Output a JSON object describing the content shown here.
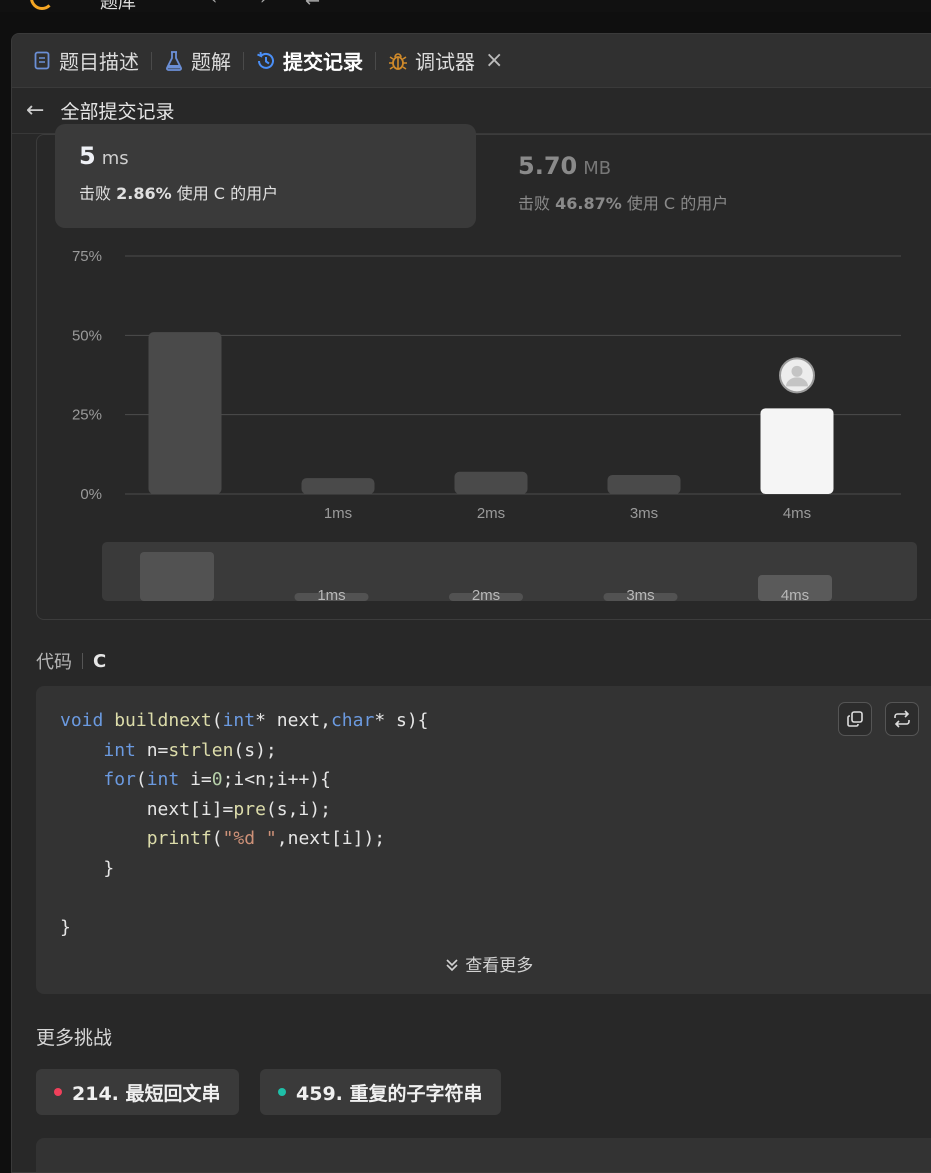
{
  "topbar": {
    "title": "题库",
    "nav_back": "‹",
    "nav_forward": "›",
    "nav_shuffle": "⇄"
  },
  "tabs": [
    {
      "label": "题目描述",
      "icon": "document-icon"
    },
    {
      "label": "题解",
      "icon": "flask-icon"
    },
    {
      "label": "提交记录",
      "icon": "history-icon"
    },
    {
      "label": "调试器",
      "icon": "bug-icon"
    }
  ],
  "tab_close": "×",
  "subheader": {
    "back": "←",
    "title": "全部提交记录"
  },
  "runtime": {
    "value": "5",
    "unit": "ms",
    "beat_prefix": "击败",
    "beat_pct": "2.86%",
    "beat_suffix": "使用 C 的用户"
  },
  "memory": {
    "value": "5.70",
    "unit": "MB",
    "beat_prefix": "击败",
    "beat_pct": "46.87%",
    "beat_suffix": "使用 C 的用户"
  },
  "chart_data": {
    "type": "bar",
    "categories": [
      "",
      "1ms",
      "2ms",
      "3ms",
      "4ms"
    ],
    "values": [
      51,
      5,
      7,
      6,
      27
    ],
    "highlight_index": 4,
    "y_ticks": [
      "75%",
      "50%",
      "25%",
      "0%"
    ],
    "ylim": [
      0,
      75
    ],
    "grid": true,
    "colors": {
      "bar": "#4a4a4a",
      "highlight": "#f5f5f5",
      "grid": "#4d4d4d",
      "tick": "#9a9a9a"
    },
    "overview": {
      "values": [
        51,
        5,
        7,
        6,
        27
      ]
    }
  },
  "code_section": {
    "label": "代码",
    "lang": "C"
  },
  "code_more": "查看更多",
  "challenges": {
    "title": "更多挑战",
    "items": [
      {
        "label": "214. 最短回文串",
        "color": "#f0405b"
      },
      {
        "label": "459. 重复的子字符串",
        "color": "#1fbfa8"
      }
    ]
  }
}
